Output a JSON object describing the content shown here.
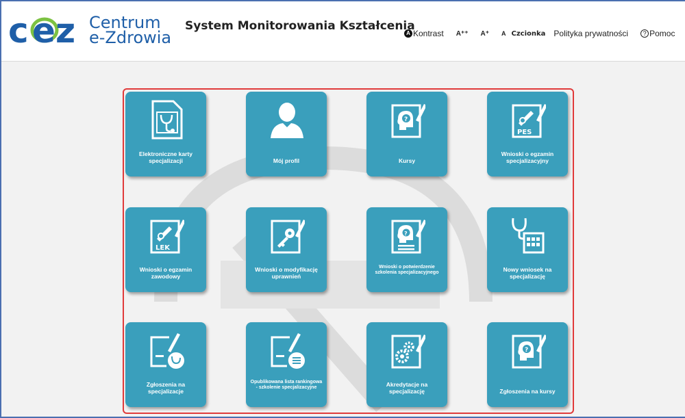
{
  "header": {
    "logo_line1": "Centrum",
    "logo_line2": "e-Zdrowia",
    "system_title": "System Monitorowania Kształcenia",
    "nav": {
      "contrast": "Kontrast",
      "font_large": "A⁺⁺",
      "font_medium": "A⁺",
      "font_small": "A",
      "font_label": "Czcionka",
      "privacy": "Polityka prywatności",
      "help": "Pomoc"
    }
  },
  "tiles": [
    {
      "label": "Elektroniczne karty specjalizacji",
      "icon": "sim-card-stethoscope-icon"
    },
    {
      "label": "Mój profil",
      "icon": "user-profile-icon"
    },
    {
      "label": "Kursy",
      "icon": "head-question-pen-icon"
    },
    {
      "label": "Wnioski o egzamin specjalizacyjny",
      "icon": "pes-certificate-pen-icon"
    },
    {
      "label": "Wnioski o egzamin zawodowy",
      "icon": "lek-certificate-pen-icon"
    },
    {
      "label": "Wnioski o modyfikację uprawnień",
      "icon": "key-pen-icon"
    },
    {
      "label": "Wnioski o potwierdzenie szkolenia specjalizacyjnego",
      "icon": "head-question-list-pen-icon"
    },
    {
      "label": "Nowy wniosek na specjalizację",
      "icon": "stethoscope-calendar-icon"
    },
    {
      "label": "Zgłoszenia na specjalizacje",
      "icon": "pen-stethoscope-icon"
    },
    {
      "label": "Opublikowana lista rankingowa - szkolenie specjalizacyjne",
      "icon": "pen-list-icon"
    },
    {
      "label": "Akredytacje na specjalizację",
      "icon": "gears-pen-icon"
    },
    {
      "label": "Zgłoszenia na kursy",
      "icon": "head-question-pen-icon"
    }
  ],
  "colors": {
    "tile": "#3a9fbc",
    "panel_border": "#e03a3a",
    "logo_blue": "#1f5fa8",
    "logo_green": "#7cc242"
  }
}
